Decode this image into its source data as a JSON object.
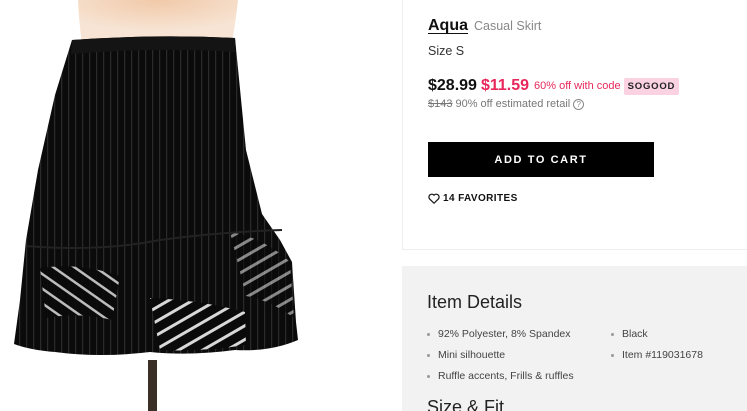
{
  "product": {
    "brand": "Aqua",
    "category": "Casual Skirt",
    "size_label": "Size S",
    "image_icon": "skirt-photo",
    "price": {
      "original": "$28.99",
      "sale": "$11.59",
      "off_text": "60% off with code",
      "code": "SOGOOD",
      "retail": "$143",
      "retail_text": "90% off estimated retail",
      "help_icon": "question-circle-icon",
      "help_glyph": "?"
    },
    "cart_label": "ADD TO CART",
    "favorites_label": "14 FAVORITES",
    "favorites_icon": "heart-icon"
  },
  "details": {
    "title": "Item Details",
    "left_items": [
      "92% Polyester, 8% Spandex",
      "Mini silhouette",
      "Ruffle accents, Frills & ruffles"
    ],
    "right_items": [
      "Black",
      "Item #119031678"
    ]
  },
  "size_fit": {
    "title": "Size & Fit"
  },
  "colors": {
    "accent_pink": "#e8285c",
    "code_bg": "#fbd2e2",
    "button_bg": "#000000",
    "details_bg": "#f2f2f2"
  }
}
